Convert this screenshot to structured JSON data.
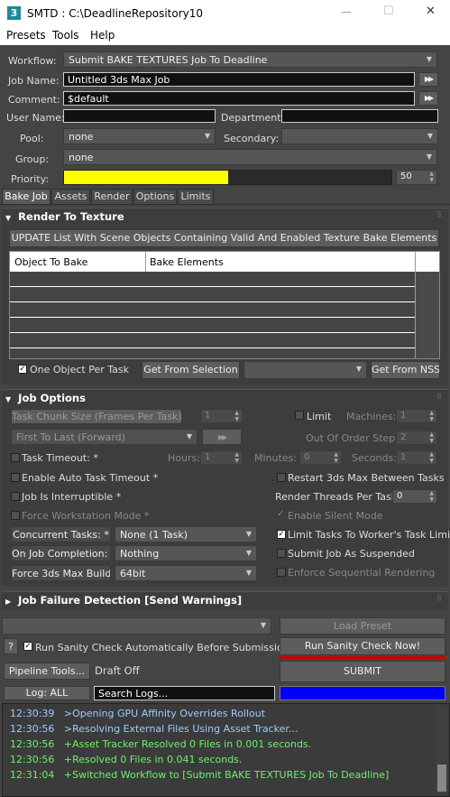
{
  "window": {
    "title": "SMTD : C:\\DeadlineRepository10",
    "app_icon": "3",
    "min": "—",
    "max": "☐",
    "close": "✕"
  },
  "menu": [
    "Presets",
    "Tools",
    "Help"
  ],
  "form": {
    "workflow_label": "Workflow:",
    "workflow_value": "Submit BAKE TEXTURES Job To Deadline",
    "jobname_label": "Job Name:",
    "jobname_value": "Untitled 3ds Max Job",
    "comment_label": "Comment:",
    "comment_value": "$default",
    "username_label": "User Name:",
    "username_value": "",
    "department_label": "Department:",
    "department_value": "",
    "pool_label": "Pool:",
    "pool_value": "none",
    "secondary_label": "Secondary:",
    "secondary_value": "",
    "group_label": "Group:",
    "group_value": "none",
    "priority_label": "Priority:",
    "priority_value": "50",
    "priority_fraction": 0.5,
    "arrows": "▶▶"
  },
  "tabs": [
    "Bake Job",
    "Assets",
    "Render",
    "Options",
    "Limits"
  ],
  "bake": {
    "header": "Render To Texture",
    "update_button": "UPDATE List With Scene Objects Containing Valid And Enabled Texture Bake Elements",
    "col1": "Object To Bake",
    "col2": "Bake Elements",
    "one_object": "One Object Per Task",
    "get_selection": "Get From Selection",
    "get_nss": "Get From NSS"
  },
  "job": {
    "header": "Job Options",
    "chunk": "Task Chunk Size (Frames Per Task):",
    "chunk_value": "1",
    "limit": "Limit",
    "machines": "Machines:",
    "machines_value": "1",
    "order": "First To Last (Forward)",
    "ooo": "Out Of Order Step:",
    "ooo_value": "2",
    "timeout": "Task Timeout: *",
    "hours": "Hours:",
    "hours_value": "1",
    "minutes": "Minutes:",
    "minutes_value": "0",
    "seconds": "Seconds:",
    "seconds_value": "1",
    "auto_timeout": "Enable Auto Task Timeout *",
    "restart": "Restart 3ds Max Between Tasks",
    "interruptible": "Job Is Interruptible *",
    "render_threads": "Render Threads Per Task:",
    "render_threads_value": "0",
    "force_ws": "Force Workstation Mode *",
    "silent": "Enable Silent Mode",
    "concurrent": "Concurrent Tasks: *",
    "concurrent_value": "None (1 Task)",
    "limit_worker": "Limit Tasks To Worker's Task Limit *",
    "oncomplete": "On Job Completion: *",
    "oncomplete_value": "Nothing",
    "suspended": "Submit Job As Suspended",
    "force_build": "Force 3ds Max Build:",
    "force_build_value": "64bit",
    "sequential": "Enforce Sequential Rendering"
  },
  "failure": {
    "header": "Job Failure Detection [Send Warnings]"
  },
  "bottom": {
    "load_preset": "Load Preset",
    "question": "?",
    "sanity_auto": "Run Sanity Check Automatically Before Submission",
    "sanity_now": "Run Sanity Check Now!",
    "pipeline": "Pipeline Tools...",
    "draft": "Draft Off",
    "submit": "SUBMIT",
    "log_all": "Log: ALL",
    "search_logs": "Search Logs..."
  },
  "colors": {
    "priority": "#ffff00",
    "progress": "#0000ff",
    "submit_accent": "#cc0000"
  },
  "log": [
    {
      "time": "12:30:39",
      "msg": ">Opening GPU Affinity Overrides Rollout",
      "color": "#9ecbff"
    },
    {
      "time": "12:30:56",
      "msg": ">Resolving External Files Using Asset Tracker...",
      "color": "#9ecbff"
    },
    {
      "time": "12:30:56",
      "msg": "+Asset Tracker Resolved 0 Files in 0.001 seconds.",
      "color": "#6cf26c"
    },
    {
      "time": "12:30:56",
      "msg": "+Resolved 0 Files in 0.041 seconds.",
      "color": "#6cf26c"
    },
    {
      "time": "12:31:04",
      "msg": "+Switched Workflow to [Submit BAKE TEXTURES Job To Deadline]",
      "color": "#6cf26c"
    }
  ]
}
